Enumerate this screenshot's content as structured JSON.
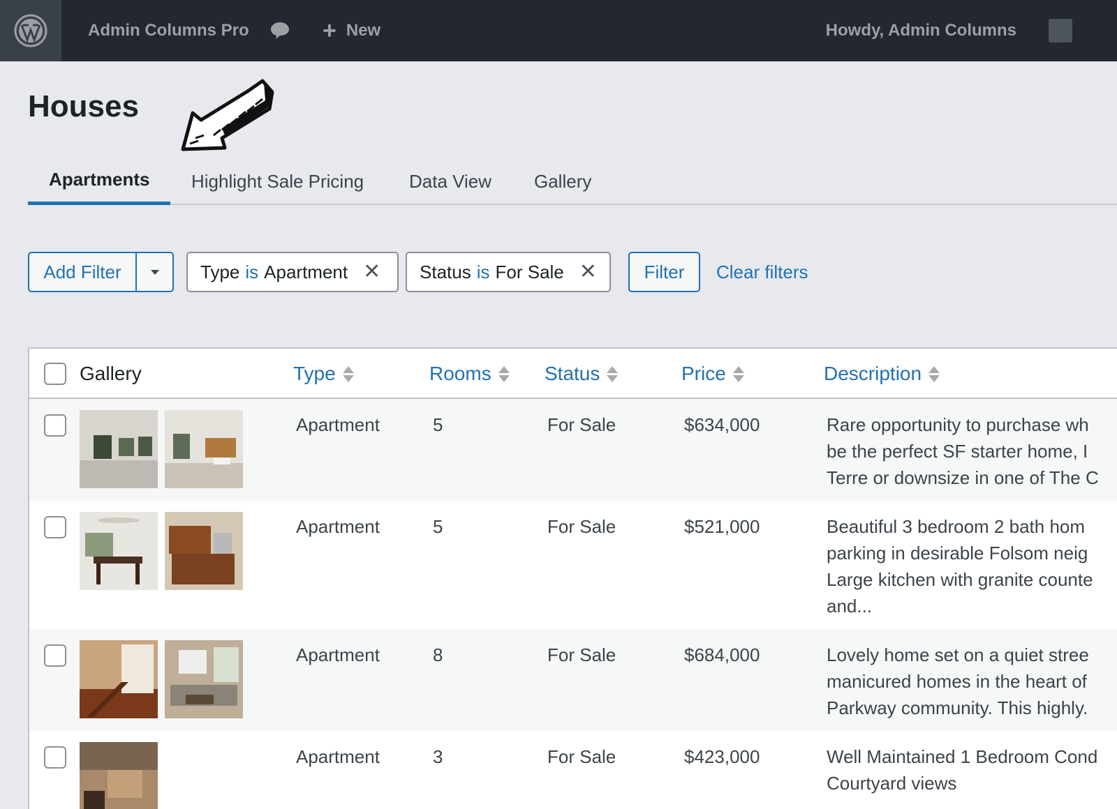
{
  "adminbar": {
    "site_name": "Admin Columns Pro",
    "new_label": "New",
    "howdy": "Howdy,  Admin Columns",
    "icons": [
      "wordpress-logo-icon",
      "comment-bubble-icon",
      "plus-icon",
      "user-avatar"
    ]
  },
  "page": {
    "title": "Houses"
  },
  "tabs": [
    {
      "label": "Apartments",
      "active": true
    },
    {
      "label": "Highlight Sale Pricing",
      "active": false
    },
    {
      "label": "Data View",
      "active": false
    },
    {
      "label": "Gallery",
      "active": false
    }
  ],
  "filters": {
    "add_filter": "Add Filter",
    "chips": [
      {
        "field": "Type",
        "operator": "is",
        "value": "Apartment"
      },
      {
        "field": "Status",
        "operator": "is",
        "value": "For Sale"
      }
    ],
    "filter_button": "Filter",
    "clear_label": "Clear filters"
  },
  "table": {
    "columns": [
      "Gallery",
      "Type",
      "Rooms",
      "Status",
      "Price",
      "Description"
    ],
    "rows": [
      {
        "type": "Apartment",
        "rooms": "5",
        "status": "For Sale",
        "price": "$634,000",
        "desc": [
          "Rare opportunity to purchase wh",
          "be the perfect SF starter home, I",
          "Terre or downsize in one of The C"
        ],
        "images": 2
      },
      {
        "type": "Apartment",
        "rooms": "5",
        "status": "For Sale",
        "price": "$521,000",
        "desc": [
          "Beautiful 3 bedroom 2 bath hom",
          "parking in desirable Folsom neig",
          "Large kitchen with granite counte",
          "and..."
        ],
        "images": 2
      },
      {
        "type": "Apartment",
        "rooms": "8",
        "status": "For Sale",
        "price": "$684,000",
        "desc": [
          "Lovely home set on a quiet stree",
          "manicured homes in the heart of",
          "Parkway community. This highly."
        ],
        "images": 2
      },
      {
        "type": "Apartment",
        "rooms": "3",
        "status": "For Sale",
        "price": "$423,000",
        "desc": [
          "Well Maintained 1 Bedroom Cond",
          "Courtyard views"
        ],
        "images": 1
      }
    ]
  },
  "colors": {
    "accent": "#2271b1",
    "adminbar": "#23282f",
    "background": "#e7e9ee"
  }
}
